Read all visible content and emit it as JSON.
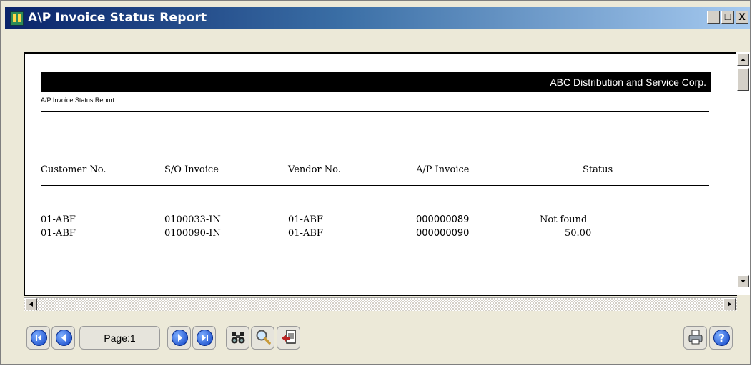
{
  "window": {
    "title": "A\\P Invoice Status Report",
    "controls": [
      "_",
      "□",
      "X"
    ]
  },
  "report": {
    "company": "ABC Distribution and Service Corp.",
    "subtitle": "A/P Invoice Status Report",
    "columns": [
      "Customer No.",
      "S/O Invoice",
      "Vendor No.",
      "A/P Invoice",
      "Status"
    ],
    "rows": [
      {
        "customer": "01-ABF",
        "so_invoice": "0100033-IN",
        "vendor": "01-ABF",
        "ap_invoice": "000000089",
        "status": "Not found"
      },
      {
        "customer": "01-ABF",
        "so_invoice": "0100090-IN",
        "vendor": "01-ABF",
        "ap_invoice": "000000090",
        "status": "50.00"
      }
    ]
  },
  "toolbar": {
    "page_label": "Page:1",
    "icons": [
      "first-page-icon",
      "previous-page-icon",
      "next-page-icon",
      "last-page-icon",
      "find-icon",
      "zoom-icon",
      "export-icon",
      "print-icon",
      "help-icon"
    ]
  },
  "colors": {
    "title_bar": "#0a246a",
    "nav_button": "#0b3fc4"
  }
}
